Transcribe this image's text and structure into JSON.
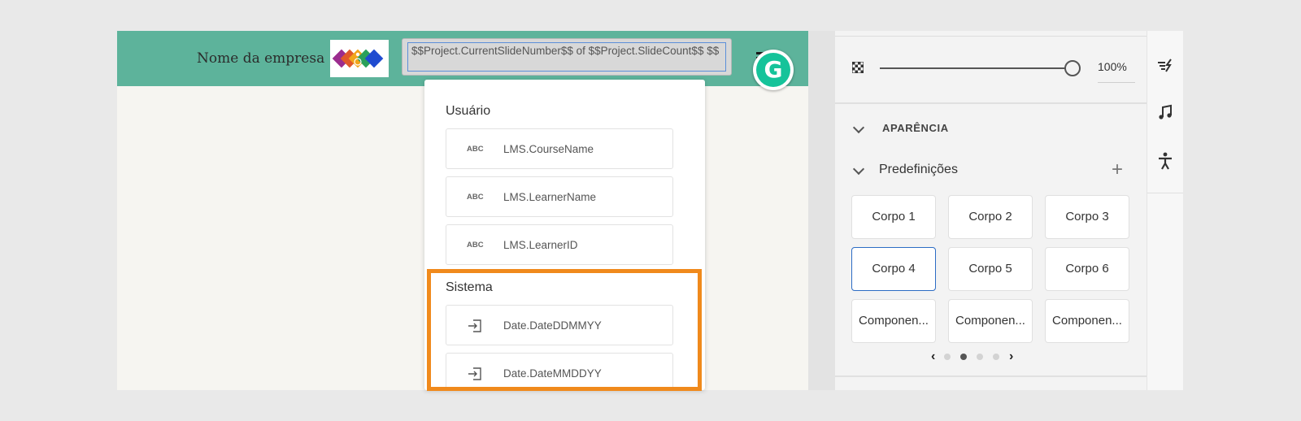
{
  "slide": {
    "company_name": "Nome da empresa",
    "variable_field": "$$Project.CurrentSlideNumber$$ of $$Project.SlideCount$$ $$",
    "header_color": "#5db39b"
  },
  "dropdown": {
    "sections": [
      {
        "title": "Usuário",
        "items": [
          {
            "icon": "abc-text-icon",
            "badge": "ABC",
            "label": "LMS.CourseName"
          },
          {
            "icon": "abc-text-icon",
            "badge": "ABC",
            "label": "LMS.LearnerName"
          },
          {
            "icon": "abc-text-icon",
            "badge": "ABC",
            "label": "LMS.LearnerID"
          }
        ]
      },
      {
        "title": "Sistema",
        "items": [
          {
            "icon": "insert-variable-icon",
            "label": "Date.DateDDMMYY"
          },
          {
            "icon": "insert-variable-icon",
            "label": "Date.DateMMDDYY"
          }
        ]
      }
    ],
    "highlight_color": "#f08a1c"
  },
  "panel": {
    "opacity": {
      "value_text": "100%",
      "level": 1.0
    },
    "appearance_label": "APARÊNCIA",
    "presets_label": "Predefinições",
    "add_label": "+",
    "presets": [
      {
        "label": "Corpo 1",
        "selected": false
      },
      {
        "label": "Corpo 2",
        "selected": false
      },
      {
        "label": "Corpo 3",
        "selected": false
      },
      {
        "label": "Corpo 4",
        "selected": true
      },
      {
        "label": "Corpo 5",
        "selected": false
      },
      {
        "label": "Corpo 6",
        "selected": false
      },
      {
        "label": "Componen...",
        "selected": false
      },
      {
        "label": "Componen...",
        "selected": false
      },
      {
        "label": "Componen...",
        "selected": false
      }
    ],
    "carousel": {
      "pages": 4,
      "active_page": 2,
      "prev": "‹",
      "next": "›"
    }
  },
  "rail": {
    "icons": [
      "transition-icon",
      "audio-icon",
      "accessibility-icon"
    ]
  },
  "colors": {
    "accent_blue": "#2c6cc4",
    "grammarly_green": "#15c39a"
  }
}
